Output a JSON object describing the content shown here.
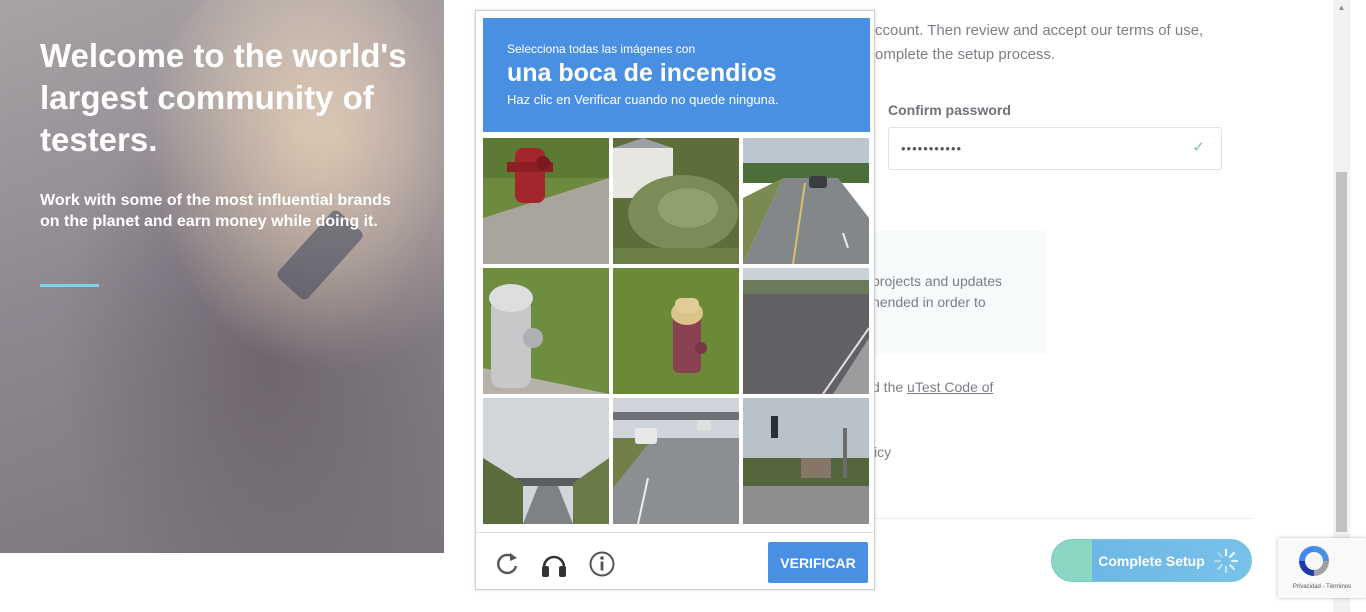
{
  "hero": {
    "title": "Welcome to the world's largest community of testers.",
    "subtitle": "Work with some of the most influential brands on the planet and earn money while doing it."
  },
  "form": {
    "intro_line1": "ccount. Then review and accept our terms of use,",
    "intro_line2": "omplete the setup process.",
    "confirm_password_label": "Confirm password",
    "confirm_password_value": "•••••••••••",
    "notice_line1": "projects and updates",
    "notice_line2": "nended in order to",
    "code_prefix": "d the",
    "code_link": "uTest Code of",
    "policy_fragment": "icy",
    "complete_button": "Complete Setup"
  },
  "captcha": {
    "instruction_line1": "Selecciona todas las imágenes con",
    "instruction_target": "una boca de incendios",
    "instruction_line3": "Haz clic en Verificar cuando no quede ninguna.",
    "verify_button": "VERIFICAR",
    "tiles": [
      {
        "subject": "hydrant-red"
      },
      {
        "subject": "palm-tree-house"
      },
      {
        "subject": "road-car"
      },
      {
        "subject": "hydrant-silver"
      },
      {
        "subject": "hydrant-yellow"
      },
      {
        "subject": "road-intersection"
      },
      {
        "subject": "highway-bridge"
      },
      {
        "subject": "highway-cars"
      },
      {
        "subject": "traffic-light-street"
      }
    ]
  },
  "recaptcha_badge": {
    "text": "Privacidad - Términos"
  },
  "colors": {
    "captcha_blue": "#4a90e2",
    "accent_teal": "#7ad3e6",
    "check_green": "#6ad0a2"
  }
}
